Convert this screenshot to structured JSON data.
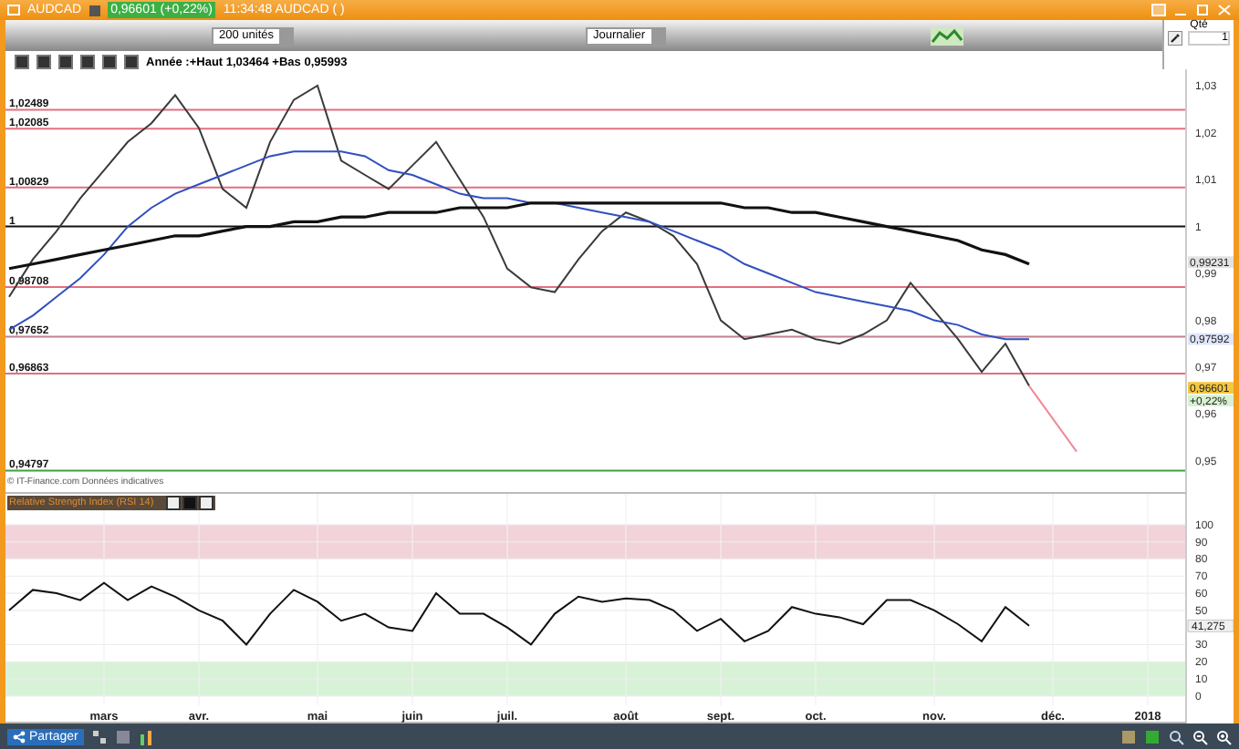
{
  "title_bar": {
    "symbol": "AUDCAD",
    "quote": "0,96601 (+0,22%)",
    "time": "11:34:48 AUDCAD ( )"
  },
  "toolbar": {
    "size_select": "200 unités",
    "period_select": "Journalier",
    "quantity": {
      "label": "Qté",
      "value": "1"
    }
  },
  "price_panel": {
    "header": "Année :+Haut 1,03464 +Bas 0,95993",
    "copyright": "© IT-Finance.com  Données indicatives",
    "chart_data": {
      "type": "line",
      "series": [
        {
          "color": "#3a3a3a",
          "values": [
            0.985,
            0.993,
            0.999,
            1.006,
            1.012,
            1.018,
            1.022,
            1.028,
            1.021,
            1.008,
            1.004,
            1.018,
            1.027,
            1.03,
            1.014,
            1.011,
            1.008,
            1.013,
            1.018,
            1.01,
            1.002,
            0.991,
            0.987,
            0.986,
            0.993,
            0.999,
            1.003,
            1.001,
            0.998,
            0.992,
            0.98,
            0.976,
            0.977,
            0.978,
            0.976,
            0.975,
            0.977,
            0.98,
            0.988,
            0.982,
            0.976,
            0.969,
            0.975,
            0.966,
            null,
            null,
            null,
            null,
            null,
            null
          ]
        },
        {
          "color": "#3050c0",
          "values": [
            0.978,
            0.981,
            0.985,
            0.989,
            0.994,
            1.0,
            1.004,
            1.007,
            1.009,
            1.011,
            1.013,
            1.015,
            1.016,
            1.016,
            1.016,
            1.015,
            1.012,
            1.011,
            1.009,
            1.007,
            1.006,
            1.006,
            1.005,
            1.005,
            1.004,
            1.003,
            1.002,
            1.001,
            0.999,
            0.997,
            0.995,
            0.992,
            0.99,
            0.988,
            0.986,
            0.985,
            0.984,
            0.983,
            0.982,
            0.98,
            0.979,
            0.977,
            0.976,
            0.976,
            null,
            null,
            null,
            null,
            null,
            null
          ]
        },
        {
          "color": "#111111",
          "values": [
            0.991,
            0.992,
            0.993,
            0.994,
            0.995,
            0.996,
            0.997,
            0.998,
            0.998,
            0.999,
            1.0,
            1.0,
            1.001,
            1.001,
            1.002,
            1.002,
            1.003,
            1.003,
            1.003,
            1.004,
            1.004,
            1.004,
            1.005,
            1.005,
            1.005,
            1.005,
            1.005,
            1.005,
            1.005,
            1.005,
            1.005,
            1.004,
            1.004,
            1.003,
            1.003,
            1.002,
            1.001,
            1.0,
            0.999,
            0.998,
            0.997,
            0.995,
            0.994,
            0.992,
            null,
            null,
            null,
            null,
            null,
            null
          ]
        },
        {
          "color": "#f08898",
          "values": [
            null,
            null,
            null,
            null,
            null,
            null,
            null,
            null,
            null,
            null,
            null,
            null,
            null,
            null,
            null,
            null,
            null,
            null,
            null,
            null,
            null,
            null,
            null,
            null,
            null,
            null,
            null,
            null,
            null,
            null,
            null,
            null,
            null,
            null,
            null,
            null,
            null,
            null,
            null,
            null,
            null,
            null,
            null,
            0.966,
            0.959,
            0.952,
            null,
            null,
            null,
            null
          ]
        }
      ],
      "ylim": [
        0.943,
        1.0374
      ],
      "yticks": [
        {
          "value": 0.95,
          "label": "0,95"
        },
        {
          "value": 0.96,
          "label": "0,96"
        },
        {
          "value": 0.97,
          "label": "0,97"
        },
        {
          "value": 0.98,
          "label": "0,98"
        },
        {
          "value": 0.99,
          "label": "0,99"
        },
        {
          "value": 1,
          "label": "1"
        },
        {
          "value": 1.01,
          "label": "1,01"
        },
        {
          "value": 1.02,
          "label": "1,02"
        },
        {
          "value": 1.03,
          "label": "1,03"
        }
      ],
      "ref_lines": [
        {
          "axis": "y",
          "value": 1.02489,
          "label": "1,02489",
          "color": "#e07080"
        },
        {
          "axis": "y",
          "value": 1.02085,
          "label": "1,02085",
          "color": "#e07080"
        },
        {
          "axis": "y",
          "value": 1.00829,
          "label": "1,00829",
          "color": "#e07080"
        },
        {
          "axis": "y",
          "value": 1,
          "label": "1",
          "color": "#111111"
        },
        {
          "axis": "y",
          "value": 0.98708,
          "label": "0,98708",
          "color": "#e07080"
        },
        {
          "axis": "y",
          "value": 0.97652,
          "label": "0,97652",
          "color": "#c08090"
        },
        {
          "axis": "y",
          "value": 0.96863,
          "label": "0,96863",
          "color": "#e07080"
        },
        {
          "axis": "y",
          "value": 0.94797,
          "label": "0,94797",
          "color": "#40a040"
        }
      ]
    },
    "tags": [
      {
        "kind": "long_average",
        "text": "0,99231",
        "color": "#e2e2e2"
      },
      {
        "kind": "short_average",
        "text": "0,97592",
        "color": "#dfe6fb"
      },
      {
        "kind": "last",
        "text": "0,96601",
        "color": "#f5c842"
      },
      {
        "kind": "change",
        "text": "+0,22%",
        "color": "#d8f2d0"
      }
    ]
  },
  "rsi_panel": {
    "title": "Relative Strength Index (RSI 14)",
    "value_tag": "41,275",
    "chart_data": {
      "type": "line",
      "categories": [
        null,
        null,
        null,
        null,
        "mars",
        null,
        null,
        null,
        "avr.",
        null,
        null,
        null,
        null,
        "mai",
        null,
        null,
        null,
        "juin",
        null,
        null,
        null,
        "juil.",
        null,
        null,
        null,
        null,
        "août",
        null,
        null,
        null,
        "sept.",
        null,
        null,
        null,
        "oct.",
        null,
        null,
        null,
        null,
        "nov.",
        null,
        null,
        null,
        null,
        "déc.",
        null,
        null,
        null,
        "2018",
        null
      ],
      "series": [
        {
          "color": "#111111",
          "values": [
            50,
            62,
            60,
            56,
            66,
            56,
            64,
            58,
            50,
            44,
            30,
            48,
            62,
            55,
            44,
            48,
            40,
            38,
            60,
            48,
            48,
            40,
            30,
            48,
            58,
            55,
            57,
            56,
            50,
            38,
            45,
            32,
            38,
            52,
            48,
            46,
            42,
            56,
            56,
            50,
            42,
            32,
            52,
            41,
            null,
            null,
            null,
            null,
            null,
            null
          ]
        }
      ],
      "ylim": [
        -16,
        118
      ],
      "yticks": [
        0,
        10,
        20,
        30,
        50,
        60,
        70,
        80,
        90,
        100
      ],
      "grid": true,
      "bands": [
        {
          "axis": "y",
          "from": 80,
          "to": 100,
          "color": "#f2d3da"
        },
        {
          "axis": "y",
          "from": 0,
          "to": 20,
          "color": "#d8f2d8"
        }
      ]
    }
  },
  "bottom_bar": {
    "share_button": "Partager"
  }
}
